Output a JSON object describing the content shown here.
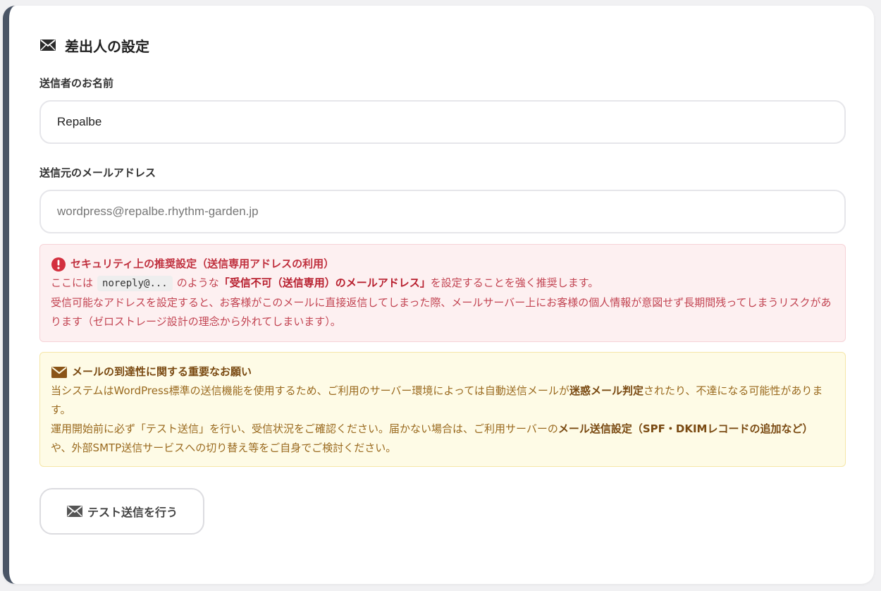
{
  "section": {
    "title": "差出人の設定",
    "icon": "envelope-icon"
  },
  "sender_name": {
    "label": "送信者のお名前",
    "value": "Repalbe"
  },
  "sender_email": {
    "label": "送信元のメールアドレス",
    "placeholder": "wordpress@repalbe.rhythm-garden.jp"
  },
  "security_notice": {
    "icon": "exclamation-circle-icon",
    "title": "セキュリティ上の推奨設定（送信専用アドレスの利用）",
    "line1_pre": "ここには",
    "line1_code": "noreply@...",
    "line1_mid": "のような",
    "line1_bold": "「受信不可（送信専用）のメールアドレス」",
    "line1_post": "を設定することを強く推奨します。",
    "line2": "受信可能なアドレスを設定すると、お客様がこのメールに直接返信してしまった際、メールサーバー上にお客様の個人情報が意図せず長期間残ってしまうリスクがあります（ゼロストレージ設計の理念から外れてしまいます）。"
  },
  "delivery_notice": {
    "icon": "envelope-icon",
    "title": "メールの到達性に関する重要なお願い",
    "p1_pre": "当システムはWordPress標準の送信機能を使用するため、ご利用のサーバー環境によっては自動送信メールが",
    "p1_bold": "迷惑メール判定",
    "p1_post": "されたり、不達になる可能性があります。",
    "p2_pre": "運用開始前に必ず「テスト送信」を行い、受信状況をご確認ください。届かない場合は、ご利用サーバーの",
    "p2_bold": "メール送信設定（SPF・DKIMレコードの追加など）",
    "p2_post": "や、外部SMTP送信サービスへの切り替え等をご自身でご検討ください。"
  },
  "test_button": {
    "icon": "envelope-icon",
    "label": "テスト送信を行う"
  },
  "colors": {
    "card_accent": "#4a5566",
    "danger_text": "#c24452",
    "danger_bg": "#fdf0f1",
    "warn_text": "#9a6a1f",
    "warn_bg": "#fefbe6"
  }
}
